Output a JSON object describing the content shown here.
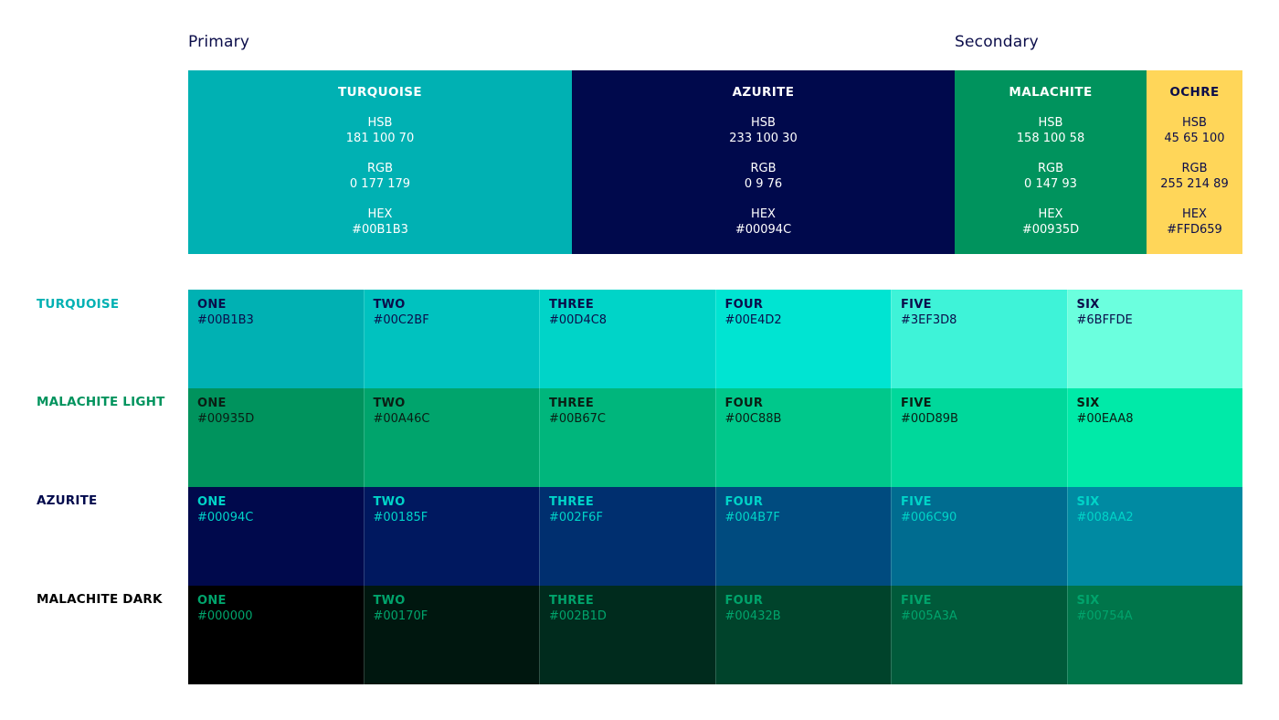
{
  "headers": {
    "primary": "Primary",
    "secondary": "Secondary"
  },
  "top_swatches": [
    {
      "name": "TURQUOISE",
      "hsb_label": "HSB",
      "hsb": "181 100 70",
      "rgb_label": "RGB",
      "rgb": "0 177 179",
      "hex_label": "HEX",
      "hex": "#00B1B3",
      "bg": "#00B1B3",
      "fg": "#FFFFFF"
    },
    {
      "name": "AZURITE",
      "hsb_label": "HSB",
      "hsb": "233 100 30",
      "rgb_label": "RGB",
      "rgb": "0 9 76",
      "hex_label": "HEX",
      "hex": "#00094C",
      "bg": "#00094C",
      "fg": "#FFFFFF"
    },
    {
      "name": "MALACHITE",
      "hsb_label": "HSB",
      "hsb": "158 100 58",
      "rgb_label": "RGB",
      "rgb": "0 147 93",
      "hex_label": "HEX",
      "hex": "#00935D",
      "bg": "#00935D",
      "fg": "#FFFFFF"
    },
    {
      "name": "OCHRE",
      "hsb_label": "HSB",
      "hsb": "45 65 100",
      "rgb_label": "RGB",
      "rgb": "255 214 89",
      "hex_label": "HEX",
      "hex": "#FFD659",
      "bg": "#FFD659",
      "fg": "#0B0D4A"
    }
  ],
  "rows": [
    {
      "label": "TURQUOISE",
      "label_color": "#00B1B3",
      "text_color": "#0B0D4A",
      "cells": [
        {
          "name": "ONE",
          "hex": "#00B1B3",
          "bg": "#00B1B3"
        },
        {
          "name": "TWO",
          "hex": "#00C2BF",
          "bg": "#00C2BF"
        },
        {
          "name": "THREE",
          "hex": "#00D4C8",
          "bg": "#00D4C8"
        },
        {
          "name": "FOUR",
          "hex": "#00E4D2",
          "bg": "#00E4D2"
        },
        {
          "name": "FIVE",
          "hex": "#3EF3D8",
          "bg": "#3EF3D8"
        },
        {
          "name": "SIX",
          "hex": "#6BFFDE",
          "bg": "#6BFFDE"
        }
      ]
    },
    {
      "label": "MALACHITE LIGHT",
      "label_color": "#00935D",
      "text_color": "#0A1E14",
      "cells": [
        {
          "name": "ONE",
          "hex": "#00935D",
          "bg": "#00935D"
        },
        {
          "name": "TWO",
          "hex": "#00A46C",
          "bg": "#00A46C"
        },
        {
          "name": "THREE",
          "hex": "#00B67C",
          "bg": "#00B67C"
        },
        {
          "name": "FOUR",
          "hex": "#00C88B",
          "bg": "#00C88B"
        },
        {
          "name": "FIVE",
          "hex": "#00D89B",
          "bg": "#00D89B"
        },
        {
          "name": "SIX",
          "hex": "#00EAA8",
          "bg": "#00EAA8"
        }
      ]
    },
    {
      "label": "AZURITE",
      "label_color": "#00094C",
      "text_color": "#00D4C8",
      "cells": [
        {
          "name": "ONE",
          "hex": "#00094C",
          "bg": "#00094C"
        },
        {
          "name": "TWO",
          "hex": "#00185F",
          "bg": "#00185F"
        },
        {
          "name": "THREE",
          "hex": "#002F6F",
          "bg": "#002F6F"
        },
        {
          "name": "FOUR",
          "hex": "#004B7F",
          "bg": "#004B7F"
        },
        {
          "name": "FIVE",
          "hex": "#006C90",
          "bg": "#006C90"
        },
        {
          "name": "SIX",
          "hex": "#008AA2",
          "bg": "#008AA2"
        }
      ]
    },
    {
      "label": "MALACHITE DARK",
      "label_color": "#000000",
      "text_color": "#00A46C",
      "cells": [
        {
          "name": "ONE",
          "hex": "#000000",
          "bg": "#000000"
        },
        {
          "name": "TWO",
          "hex": "#00170F",
          "bg": "#00170F"
        },
        {
          "name": "THREE",
          "hex": "#002B1D",
          "bg": "#002B1D"
        },
        {
          "name": "FOUR",
          "hex": "#00432B",
          "bg": "#00432B"
        },
        {
          "name": "FIVE",
          "hex": "#005A3A",
          "bg": "#005A3A"
        },
        {
          "name": "SIX",
          "hex": "#00754A",
          "bg": "#00754A"
        }
      ]
    }
  ]
}
